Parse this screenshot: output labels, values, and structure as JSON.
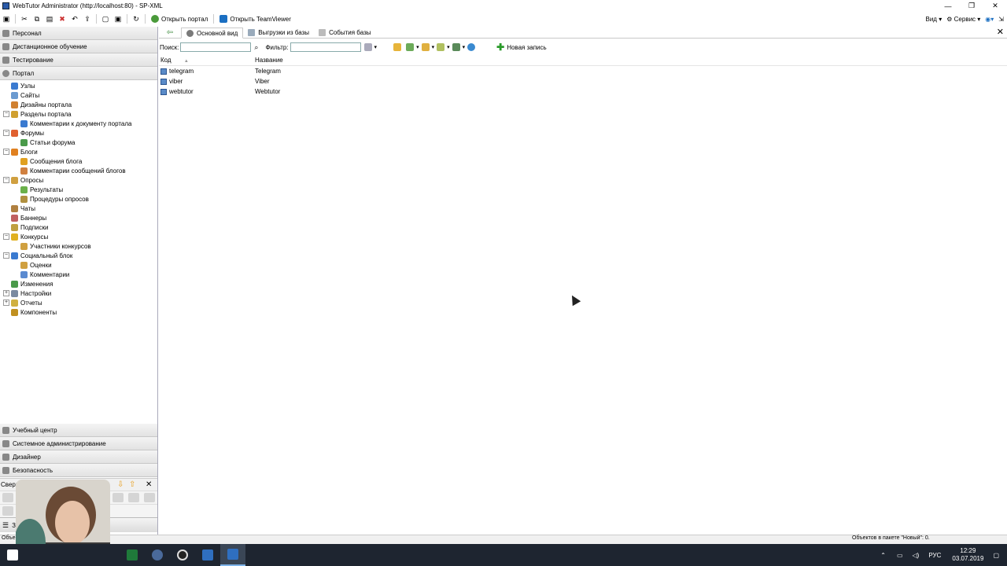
{
  "window": {
    "title": "WebTutor Administrator (http://localhost:80) - SP-XML"
  },
  "toolbar": {
    "open_portal": "Открыть портал",
    "open_teamviewer": "Открыть TeamViewer",
    "view_menu": "Вид",
    "service_menu": "Сервис"
  },
  "sidebar": {
    "top_sections": [
      "Персонал",
      "Дистанционное обучение",
      "Тестирование",
      "Портал"
    ],
    "tree": [
      {
        "label": "Узлы",
        "level": 1,
        "expander": ""
      },
      {
        "label": "Сайты",
        "level": 1,
        "expander": ""
      },
      {
        "label": "Дизайны портала",
        "level": 1,
        "expander": ""
      },
      {
        "label": "Разделы портала",
        "level": 1,
        "expander": "−"
      },
      {
        "label": "Комментарии к документу портала",
        "level": 2,
        "expander": ""
      },
      {
        "label": "Форумы",
        "level": 1,
        "expander": "−"
      },
      {
        "label": "Статьи форума",
        "level": 2,
        "expander": ""
      },
      {
        "label": "Блоги",
        "level": 1,
        "expander": "−"
      },
      {
        "label": "Сообщения блога",
        "level": 2,
        "expander": ""
      },
      {
        "label": "Комментарии сообщений блогов",
        "level": 2,
        "expander": ""
      },
      {
        "label": "Опросы",
        "level": 1,
        "expander": "−"
      },
      {
        "label": "Результаты",
        "level": 2,
        "expander": ""
      },
      {
        "label": "Процедуры опросов",
        "level": 2,
        "expander": ""
      },
      {
        "label": "Чаты",
        "level": 1,
        "expander": ""
      },
      {
        "label": "Баннеры",
        "level": 1,
        "expander": ""
      },
      {
        "label": "Подписки",
        "level": 1,
        "expander": ""
      },
      {
        "label": "Конкурсы",
        "level": 1,
        "expander": "−"
      },
      {
        "label": "Участники конкурсов",
        "level": 2,
        "expander": ""
      },
      {
        "label": "Социальный блок",
        "level": 1,
        "expander": "−"
      },
      {
        "label": "Оценки",
        "level": 2,
        "expander": ""
      },
      {
        "label": "Комментарии",
        "level": 2,
        "expander": ""
      },
      {
        "label": "Изменения",
        "level": 1,
        "expander": ""
      },
      {
        "label": "Настройки",
        "level": 1,
        "expander": "+"
      },
      {
        "label": "Отчеты",
        "level": 1,
        "expander": "+"
      },
      {
        "label": "Компоненты",
        "level": 1,
        "expander": ""
      }
    ],
    "bottom_sections": [
      "Учебный центр",
      "Системное администрирование",
      "Дизайнер",
      "Безопасность"
    ],
    "collapsed_blocks_label": "Свернутые блоки:",
    "last_row_label_a": "Закл",
    "last_row_label_b": "ки"
  },
  "main": {
    "tabs": [
      "Основной вид",
      "Выгрузки из базы",
      "События базы"
    ],
    "search_label": "Поиск:",
    "search_value": "",
    "filter_label": "Фильтр:",
    "filter_value": "",
    "new_record": "Новая запись",
    "columns": [
      "Код",
      "Название"
    ],
    "rows": [
      {
        "code": "telegram",
        "name": "Telegram"
      },
      {
        "code": "viber",
        "name": "Viber"
      },
      {
        "code": "webtutor",
        "name": "Webtutor"
      }
    ]
  },
  "status": {
    "left": "Объектов: 1",
    "right": "Объектов в пакете \"Новый\": 0."
  },
  "tray": {
    "lang": "РУС",
    "time": "12:29",
    "date": "03.07.2019"
  }
}
